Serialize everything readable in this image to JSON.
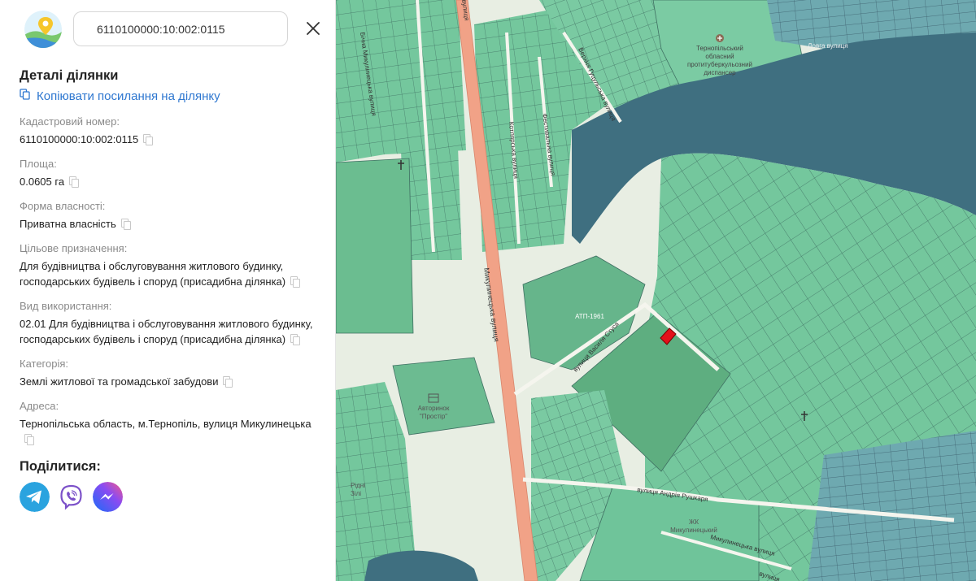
{
  "header": {
    "search_value": "6110100000:10:002:0115"
  },
  "details": {
    "title": "Деталі ділянки",
    "copy_link_label": "Копіювати посилання на ділянку",
    "fields": [
      {
        "label": "Кадастровий номер:",
        "value": "6110100000:10:002:0115"
      },
      {
        "label": "Площа:",
        "value": "0.0605 га"
      },
      {
        "label": "Форма власності:",
        "value": "Приватна власність"
      },
      {
        "label": "Цільове призначення:",
        "value": "Для будівництва і обслуговування житлового будинку, господарських будівель і споруд (присадибна ділянка)"
      },
      {
        "label": "Вид використання:",
        "value": "02.01 Для будівництва і обслуговування житлового будинку, господарських будівель і споруд (присадибна ділянка)"
      },
      {
        "label": "Категорія:",
        "value": "Землі житлової та громадської забудови"
      },
      {
        "label": "Адреса:",
        "value": "Тернопільська область, м.Тернопіль, вулиця Микулинецька"
      }
    ],
    "share_title": "Поділитися:"
  },
  "map": {
    "labels": {
      "hospital": [
        "Тернопільський",
        "обласний",
        "протитуберкульозний",
        "диспансер"
      ],
      "market": [
        "Авторинок",
        "\"Простір\""
      ],
      "atp": "АТП-1961",
      "zhk": [
        "ЖК",
        "Микулинецький"
      ],
      "ridni": [
        "Рідні",
        "Зілі"
      ],
      "streets": {
        "mykulynetska": "Микулинецька вулиця",
        "bichna": "Бічна Микулинецька вулиця",
        "upper": "вулиця",
        "verkhnia": "Верхня Гуцульська вулиця",
        "kotliarska": "Котлярська вулиця",
        "faktorialna": "Фестивальна вулиця",
        "dov": "Довга вулиця",
        "vasyl": "вулиця Василя Стуса",
        "rushkar": "вулиця Андрія Рушкаря",
        "mykul2": "Микулинецька вулиця",
        "lower": "вулиця"
      }
    },
    "colors": {
      "parcel": "#6fc49a",
      "parcel_dark": "#5a9fa0",
      "water": "#3f6f80",
      "selected": "#e4101b",
      "road": "#f1a287"
    }
  }
}
